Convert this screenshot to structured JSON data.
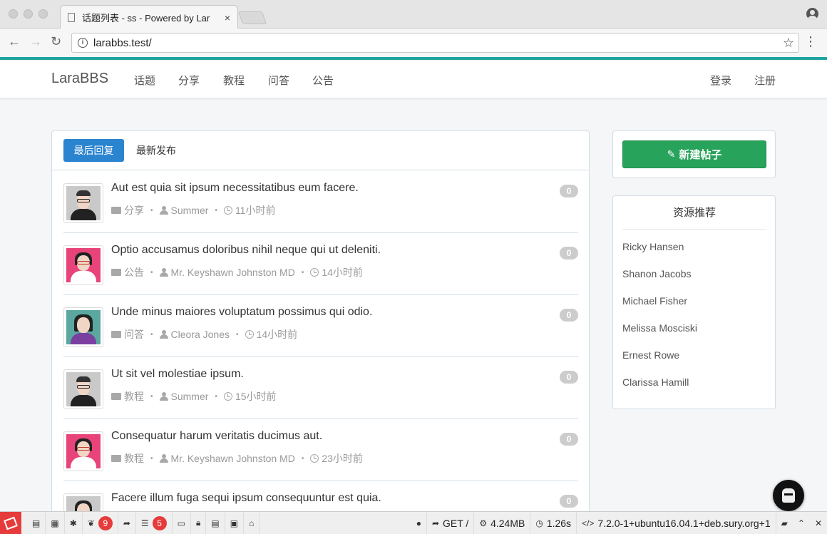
{
  "browser": {
    "tab_title": "话题列表 - ss - Powered by Lar",
    "tab_close": "×",
    "url": "larabbs.test/",
    "back": "←",
    "forward": "→",
    "reload": "↻",
    "info": "i",
    "star": "☆",
    "menu": "⋮"
  },
  "navbar": {
    "brand": "LaraBBS",
    "links": [
      "话题",
      "分享",
      "教程",
      "问答",
      "公告"
    ],
    "login": "登录",
    "register": "注册"
  },
  "filters": {
    "active": "最后回复",
    "other": "最新发布"
  },
  "topics": [
    {
      "title": "Aut est quia sit ipsum necessitatibus eum facere.",
      "category": "分享",
      "author": "Summer",
      "time": "11小时前",
      "replies": "0"
    },
    {
      "title": "Optio accusamus doloribus nihil neque qui ut deleniti.",
      "category": "公告",
      "author": "Mr. Keyshawn Johnston MD",
      "time": "14小时前",
      "replies": "0"
    },
    {
      "title": "Unde minus maiores voluptatum possimus qui odio.",
      "category": "问答",
      "author": "Cleora Jones",
      "time": "14小时前",
      "replies": "0"
    },
    {
      "title": "Ut sit vel molestiae ipsum.",
      "category": "教程",
      "author": "Summer",
      "time": "15小时前",
      "replies": "0"
    },
    {
      "title": "Consequatur harum veritatis ducimus aut.",
      "category": "教程",
      "author": "Mr. Keyshawn Johnston MD",
      "time": "23小时前",
      "replies": "0"
    },
    {
      "title": "Facere illum fuga sequi ipsum consequuntur est quia.",
      "category": "",
      "author": "",
      "time": "",
      "replies": "0"
    }
  ],
  "sidebar": {
    "new_post": "新建帖子",
    "resources_title": "资源推荐",
    "resources": [
      "Ricky Hansen",
      "Shanon Jacobs",
      "Michael Fisher",
      "Melissa Mosciski",
      "Ernest Rowe",
      "Clarissa Hamill"
    ]
  },
  "debugbar": {
    "badge_log": "9",
    "badge_queries": "5",
    "method": "GET /",
    "memory": "4.24MB",
    "duration": "1.26s",
    "php_version": "7.2.0-1+ubuntu16.04.1+deb.sury.org+1"
  },
  "colors": {
    "accent": "#20a39e",
    "primary": "#2b84d0",
    "success": "#28a35b",
    "debug_red": "#e53b3b"
  }
}
